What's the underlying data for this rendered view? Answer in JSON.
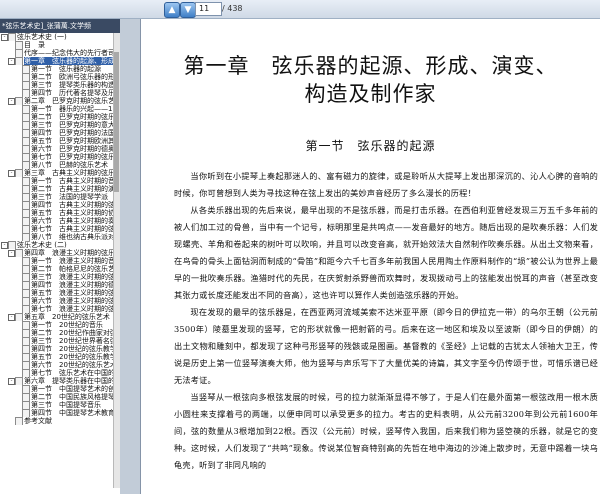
{
  "toolbar": {
    "up_icon": "arrow-up-icon",
    "down_icon": "arrow-down-icon",
    "page_current": "11",
    "page_total": "/ 438"
  },
  "sidebar": {
    "tab_title": "*弦乐艺术史]_张蒲萬.文学频",
    "items": [
      {
        "text": "弦乐艺术史 (一)",
        "level": 0,
        "exp": "-"
      },
      {
        "text": "目　录",
        "level": 1
      },
      {
        "text": "代序——纪念伟大的先行者司徒",
        "level": 1
      },
      {
        "text": "第一章　弦乐器的起源、形成、",
        "level": 1,
        "selected": true,
        "exp": "-"
      },
      {
        "text": "第一节　弦乐器的起源",
        "level": 2
      },
      {
        "text": "第二节　欧洲弓弦乐器的形",
        "level": 2
      },
      {
        "text": "第三节　提琴类乐器的构造",
        "level": 2
      },
      {
        "text": "第四节　历代著名提琴及乐",
        "level": 2
      },
      {
        "text": "第二章　巴罗克时期的弦乐艺",
        "level": 1,
        "exp": "-"
      },
      {
        "text": "第一节　器乐的兴起——17",
        "level": 2
      },
      {
        "text": "第二节　巴罗克时期的弦乐",
        "level": 2
      },
      {
        "text": "第三节　巴罗克时期的意大",
        "level": 2
      },
      {
        "text": "第四节　巴罗克时期的法国",
        "level": 2
      },
      {
        "text": "第五节　巴罗克时期欧洲其",
        "level": 2
      },
      {
        "text": "第六节　巴罗克时期的德奥",
        "level": 2
      },
      {
        "text": "第七节　巴罗克时期的弦乐",
        "level": 2
      },
      {
        "text": "第八节　巴赫的弦乐艺术",
        "level": 2
      },
      {
        "text": "第三章　古典主义时期的弦乐",
        "level": 1,
        "exp": "-"
      },
      {
        "text": "第一节　古典主义时期的音",
        "level": 2
      },
      {
        "text": "第二节　古典主义时期的演",
        "level": 2
      },
      {
        "text": "第三节　法国的提琴学派",
        "level": 2
      },
      {
        "text": "第四节　古典主义时期的弦",
        "level": 2
      },
      {
        "text": "第五节　古典主义时期的协",
        "level": 2
      },
      {
        "text": "第六节　古典主义时期的奏",
        "level": 2
      },
      {
        "text": "第七节　古典主义时期的弦",
        "level": 2
      },
      {
        "text": "第八节　维也纳古典乐派对",
        "level": 2
      },
      {
        "text": "弦乐艺术史 (二)",
        "level": 0,
        "exp": "-"
      },
      {
        "text": "第四章　浪漫主义时期的弦乐",
        "level": 1,
        "exp": "-"
      },
      {
        "text": "第一节　浪漫主义时期的音",
        "level": 2
      },
      {
        "text": "第二节　帕格尼尼的弦乐艺",
        "level": 2
      },
      {
        "text": "第三节　浪漫主义时期的弦",
        "level": 2
      },
      {
        "text": "第四节　浪漫主义时期的德",
        "level": 2
      },
      {
        "text": "第五节　浪漫主义时期的弦",
        "level": 2
      },
      {
        "text": "第六节　浪漫主义时期的弦",
        "level": 2
      },
      {
        "text": "第七节　浪漫主义时期的弦",
        "level": 2
      },
      {
        "text": "第五章　20世纪的弦乐艺术",
        "level": 1,
        "exp": "-"
      },
      {
        "text": "第一节　20世纪的音乐",
        "level": 2
      },
      {
        "text": "第二节　20世纪作曲家对弦",
        "level": 2
      },
      {
        "text": "第三节　20世纪世界著名弦",
        "level": 2
      },
      {
        "text": "第四节　20世纪的弦乐教学",
        "level": 2
      },
      {
        "text": "第五节　20世纪的弦乐教学",
        "level": 2
      },
      {
        "text": "第六节　20世纪的弦乐艺术",
        "level": 2
      },
      {
        "text": "第七节　弦乐艺术在中国的",
        "level": 2
      },
      {
        "text": "第六章　提琴类乐器在中国的",
        "level": 1,
        "exp": "-"
      },
      {
        "text": "第一节　中国提琴艺术的创作",
        "level": 2
      },
      {
        "text": "第二节　中国民族风格提琴",
        "level": 2
      },
      {
        "text": "第三节　中国提琴音乐",
        "level": 2
      },
      {
        "text": "第四节　中国提琴艺术教育",
        "level": 2
      },
      {
        "text": "参考文献",
        "level": 1
      }
    ]
  },
  "document": {
    "chapter_title_line1": "第一章　弦乐器的起源、形成、演变、",
    "chapter_title_line2": "构造及制作家",
    "section_title": "第一节　弦乐器的起源",
    "paragraphs": [
      "当你听到在小提琴上奏起那迷人的、富有磁力的旋律，或是聆听从大提琴上发出那深沉的、沁人心脾的音响的时候，你可曾想到人类为寻找这种在弦上发出的美妙声音经历了多么漫长的历程！",
      "从各类乐器出现的先后来说，最早出现的不是弦乐器，而是打击乐器。在西伯利亚曾经发现三万五千多年前的被人们加工过的骨兽，当中有一个记号，标明那里是共鸣点——发音最好的地方。随后出现的是吹奏乐器：人们发现螺壳、羊角和卷起来的树叶可以吹响，并且可以改变音高，就开始效法大自然制作吹奏乐器。从出土文物来看，在鸟骨的骨头上面钻洞而制成的“骨笛”和距今六千七百多年前我国人民用陶土作原料制作的“埙”被公认为世界上最早的一批吹奏乐器。渔猎时代的先民，在庆贺射杀野兽而欢舞时，发现拨动弓上的弦能发出悦耳的声音（甚至改变其张力或长度还能发出不同的音高），这也许可以算作人类创造弦乐器的开始。",
      "现在发现的最早的弦乐器是，在西亚两河流域美索不达米亚平原（即今日的伊拉克一带）的乌尔王朝（公元前3500年）陵墓里发现的竖琴，它的形状就像一把射箭的弓。后来在这一地区和埃及以至波斯（即今日的伊朗）的出土文物和雕刻中，都发现了这种弓形竖琴的残骸或是图画。基督教的《圣经》上记载的古犹太人领袖大卫王，传说是历史上第一位竖琴演奏大师，他为竖琴与声乐写下了大量优美的诗篇，其文字至今仍传颂于世，可惜乐谱已经无法考证。",
      "当竖琴从一根弦向多根弦发展的时候，弓的拉力就渐渐显得不够了，于是人们在最外面第一根弦改用一根木质小圆柱来支撑着弓的两端，以便申同可以承受更多的拉力。考古的史料表明，从公元前3200年到公元前1600年间，弦的数量从3根增加到22根。西汉（公元前）时候，竖琴传入我国，后来我们称为竖箜篌的乐器，就是它的变种。这时候，人们发现了“共鸣”现象。传说某位智商特别高的先哲在地中海边的沙滩上散步时，无意中踢着一块乌龟壳，听到了非同凡响的"
    ]
  }
}
